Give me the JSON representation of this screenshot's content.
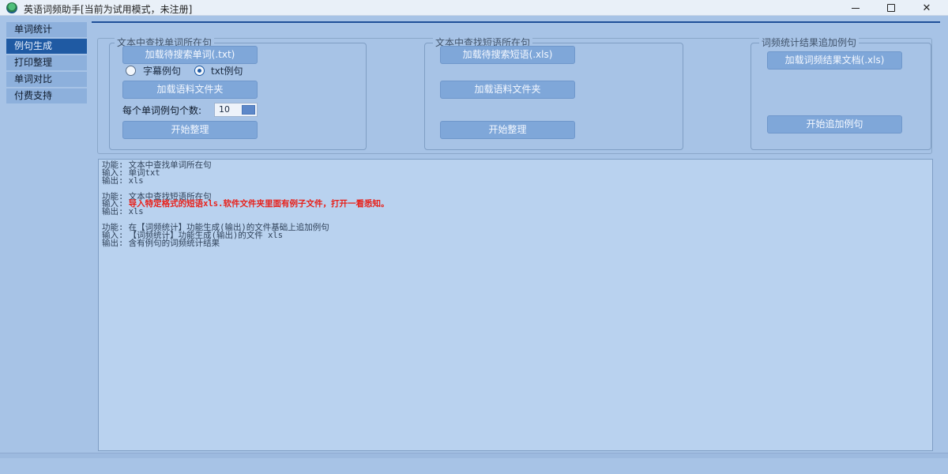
{
  "window": {
    "title": "英语词频助手[当前为试用模式，未注册]"
  },
  "sidebar": {
    "items": [
      {
        "label": "单词统计",
        "active": false
      },
      {
        "label": "例句生成",
        "active": true
      },
      {
        "label": "打印整理",
        "active": false
      },
      {
        "label": "单词对比",
        "active": false
      },
      {
        "label": "付费支持",
        "active": false
      }
    ]
  },
  "groups": {
    "word_sentences": {
      "legend": "文本中查找单词所在句",
      "load_button": "加载待搜索单词(.txt)",
      "radio_subtitle": "字幕例句",
      "radio_txt": "txt例句",
      "radio_selected": "txt例句",
      "corpus_button": "加载语料文件夹",
      "count_label": "每个单词例句个数:",
      "count_value": "10",
      "start_button": "开始整理"
    },
    "phrase_sentences": {
      "legend": "文本中查找短语所在句",
      "load_button": "加载待搜索短语(.xls)",
      "corpus_button": "加载语料文件夹",
      "start_button": "开始整理"
    },
    "append_examples": {
      "legend": "词频统计结果追加例句",
      "load_button": "加载词频结果文档(.xls)",
      "start_button": "开始追加例句"
    }
  },
  "info": {
    "lines": [
      {
        "prefix": "功能: 文本中查找单词所在句",
        "highlight": ""
      },
      {
        "prefix": "输入: 单词txt",
        "highlight": ""
      },
      {
        "prefix": "输出: xls",
        "highlight": ""
      },
      {
        "prefix": "",
        "highlight": ""
      },
      {
        "prefix": "功能: 文本中查找短语所在句",
        "highlight": ""
      },
      {
        "prefix": "输入: ",
        "highlight": "导入特定格式的短语xls.软件文件夹里面有例子文件，打开一看悉知。"
      },
      {
        "prefix": "输出: xls",
        "highlight": ""
      },
      {
        "prefix": "",
        "highlight": ""
      },
      {
        "prefix": "功能: 在【词频统计】功能生成(输出)的文件基础上追加例句",
        "highlight": ""
      },
      {
        "prefix": "输入: 【词频统计】功能生成(输出)的文件 xls",
        "highlight": ""
      },
      {
        "prefix": "输出: 含有例句的词频统计结果",
        "highlight": ""
      }
    ]
  },
  "colors": {
    "accent": "#1f5aa3",
    "background": "#a7c3e6",
    "button": "#7fa7d9",
    "highlight_text": "#e8211b"
  }
}
